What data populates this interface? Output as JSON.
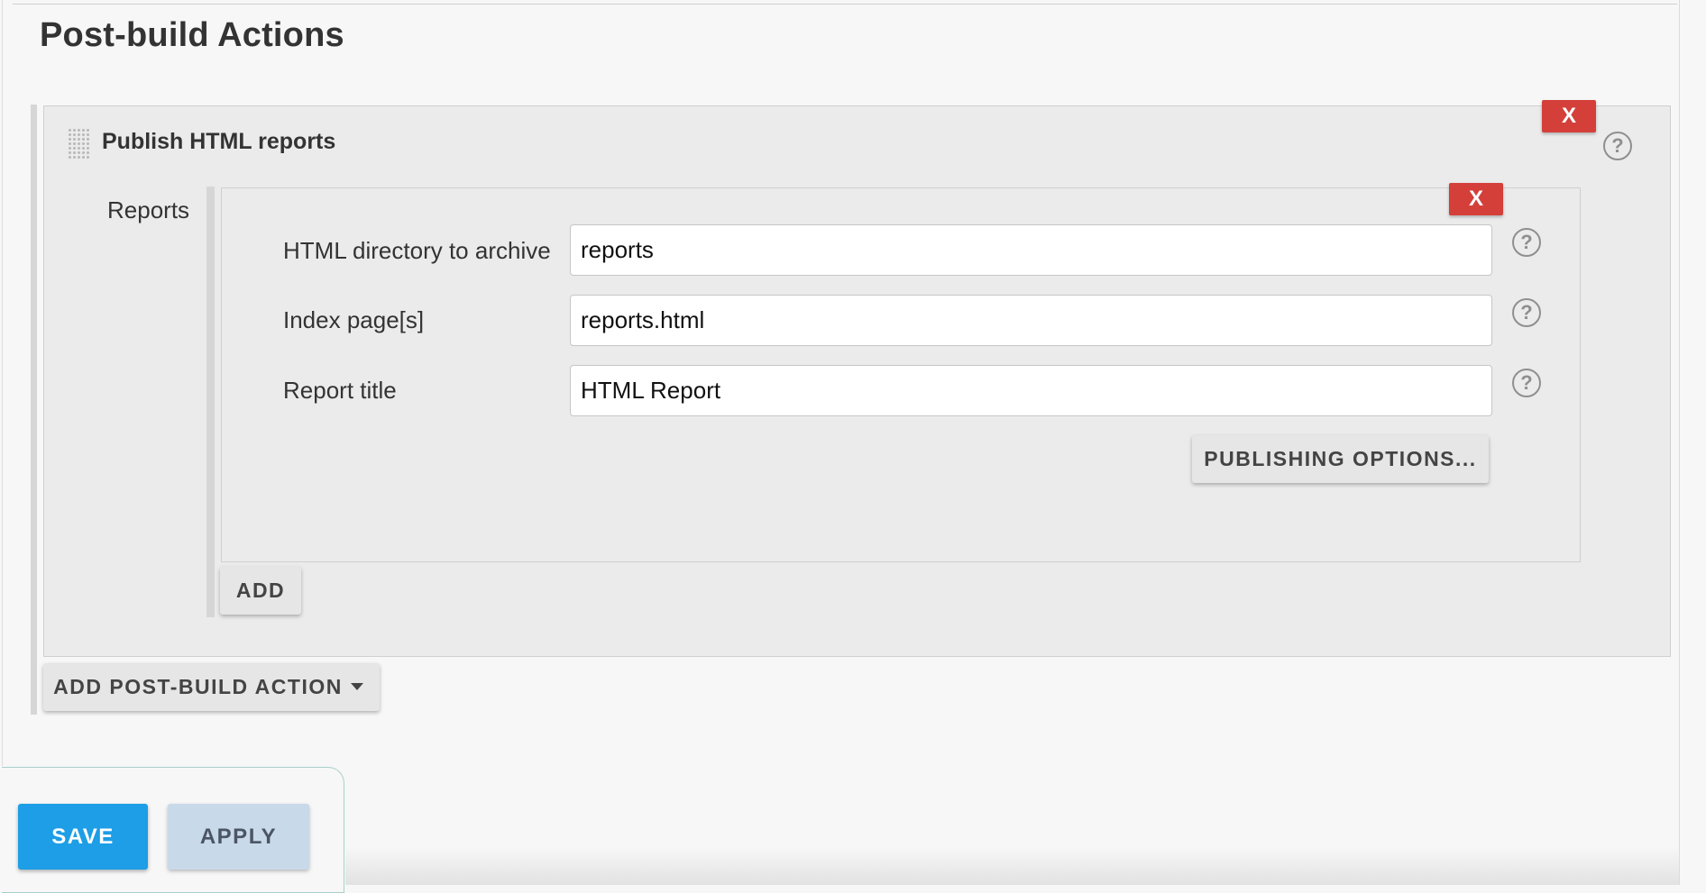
{
  "section": {
    "title": "Post-build Actions"
  },
  "publisher": {
    "title": "Publish HTML reports",
    "delete_label": "X",
    "help_label": "?",
    "reports_label": "Reports",
    "report": {
      "delete_label": "X",
      "fields": [
        {
          "label": "HTML directory to archive",
          "value": "reports",
          "help_label": "?"
        },
        {
          "label": "Index page[s]",
          "value": "reports.html",
          "help_label": "?"
        },
        {
          "label": "Report title",
          "value": "HTML Report",
          "help_label": "?"
        }
      ],
      "publishing_options_label": "PUBLISHING OPTIONS..."
    },
    "add_label": "ADD"
  },
  "add_post_build_action_label": "ADD POST-BUILD ACTION",
  "footer": {
    "save_label": "SAVE",
    "apply_label": "APPLY"
  },
  "colors": {
    "delete_red": "#d43f3a",
    "save_blue": "#1d9ee6",
    "apply_light_blue": "#c8d9ea",
    "panel_grey": "#ebebeb"
  },
  "icons": {
    "help": "question-circle-icon",
    "delete": "close-x-icon",
    "drag": "drag-handle-icon",
    "caret": "caret-down-icon"
  }
}
